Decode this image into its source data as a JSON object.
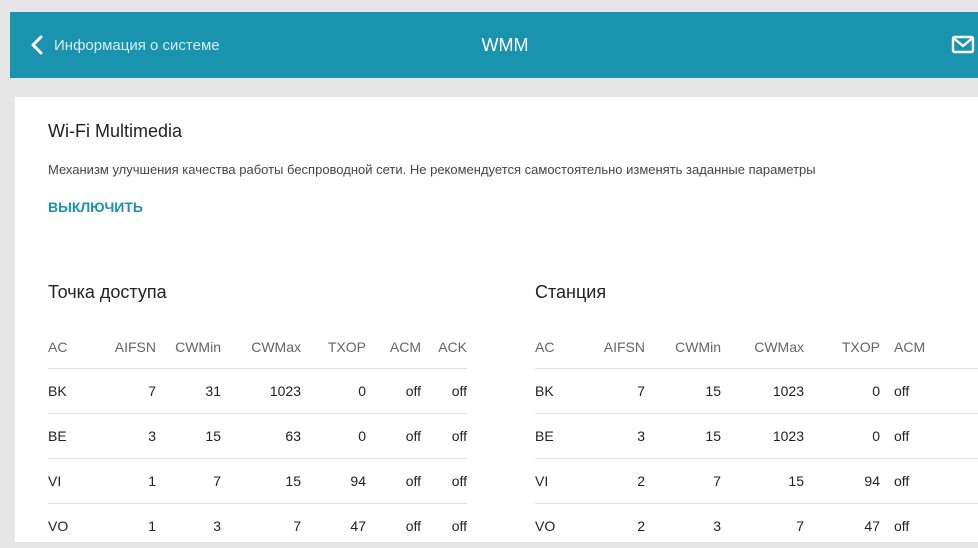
{
  "header": {
    "back_label": "Информация о системе",
    "title": "WMM"
  },
  "card": {
    "title": "Wi-Fi Multimedia",
    "description": "Механизм улучшения качества работы беспроводной сети. Не рекомендуется самостоятельно изменять заданные параметры",
    "disable_label": "ВЫКЛЮЧИТЬ"
  },
  "access_point": {
    "title": "Точка доступа",
    "columns": [
      "AC",
      "AIFSN",
      "CWMin",
      "CWMax",
      "TXOP",
      "ACM",
      "ACK"
    ],
    "rows": [
      [
        "BK",
        "7",
        "31",
        "1023",
        "0",
        "off",
        "off"
      ],
      [
        "BE",
        "3",
        "15",
        "63",
        "0",
        "off",
        "off"
      ],
      [
        "VI",
        "1",
        "7",
        "15",
        "94",
        "off",
        "off"
      ],
      [
        "VO",
        "1",
        "3",
        "7",
        "47",
        "off",
        "off"
      ]
    ]
  },
  "station": {
    "title": "Станция",
    "columns": [
      "AC",
      "AIFSN",
      "CWMin",
      "CWMax",
      "TXOP",
      "ACM"
    ],
    "rows": [
      [
        "BK",
        "7",
        "15",
        "1023",
        "0",
        "off"
      ],
      [
        "BE",
        "3",
        "15",
        "1023",
        "0",
        "off"
      ],
      [
        "VI",
        "2",
        "7",
        "15",
        "94",
        "off"
      ],
      [
        "VO",
        "2",
        "3",
        "7",
        "47",
        "off"
      ]
    ]
  },
  "colors": {
    "header_bg": "#1a93ae",
    "accent": "#1a93ae",
    "page_bg": "#e5e5e5"
  },
  "icons": {
    "back": "chevron-left-icon",
    "mail": "mail-icon"
  }
}
